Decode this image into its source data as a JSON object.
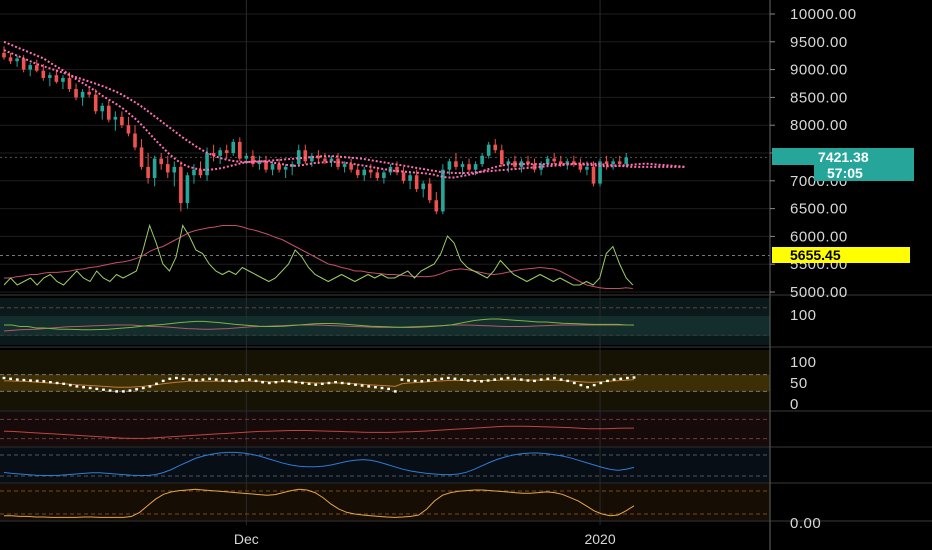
{
  "chart_data": {
    "type": "candlestick",
    "price_axis": {
      "ticks": [
        "10000.00",
        "9500.00",
        "9000.00",
        "8500.00",
        "8000.00",
        "7500.00",
        "7000.00",
        "6500.00",
        "6000.00",
        "5500.00",
        "5000.00"
      ],
      "range": [
        5000,
        10000
      ]
    },
    "last_price_tag": "7421.38",
    "countdown_tag": "57:05",
    "level_tag": "5655.45",
    "level_value": 5655.45,
    "x_labels": [
      {
        "text": "Dec",
        "index": 37
      },
      {
        "text": "2020",
        "index": 91
      }
    ],
    "candles": [
      [
        9300,
        9420,
        9180,
        9220
      ],
      [
        9220,
        9300,
        9100,
        9150
      ],
      [
        9150,
        9250,
        9050,
        9200
      ],
      [
        9200,
        9260,
        8950,
        9000
      ],
      [
        9000,
        9120,
        8880,
        9080
      ],
      [
        9080,
        9180,
        8950,
        8980
      ],
      [
        8980,
        9100,
        8800,
        8850
      ],
      [
        8850,
        8950,
        8700,
        8900
      ],
      [
        8900,
        9000,
        8750,
        8780
      ],
      [
        8780,
        8900,
        8650,
        8850
      ],
      [
        8850,
        8950,
        8600,
        8650
      ],
      [
        8650,
        8750,
        8450,
        8500
      ],
      [
        8500,
        8650,
        8350,
        8600
      ],
      [
        8600,
        8700,
        8500,
        8550
      ],
      [
        8550,
        8650,
        8200,
        8250
      ],
      [
        8250,
        8400,
        8100,
        8350
      ],
      [
        8350,
        8450,
        8050,
        8100
      ],
      [
        8100,
        8250,
        7900,
        8150
      ],
      [
        8150,
        8250,
        7950,
        8000
      ],
      [
        8000,
        8150,
        7800,
        7850
      ],
      [
        7850,
        8000,
        7550,
        7600
      ],
      [
        7600,
        7750,
        7200,
        7250
      ],
      [
        7250,
        7500,
        6950,
        7050
      ],
      [
        7050,
        7450,
        6900,
        7400
      ],
      [
        7400,
        7500,
        7200,
        7300
      ],
      [
        7300,
        7450,
        7050,
        7150
      ],
      [
        7150,
        7350,
        6900,
        7250
      ],
      [
        7250,
        7350,
        6450,
        6600
      ],
      [
        6600,
        7150,
        6500,
        7100
      ],
      [
        7100,
        7300,
        6950,
        7200
      ],
      [
        7200,
        7350,
        7050,
        7100
      ],
      [
        7100,
        7600,
        7000,
        7500
      ],
      [
        7500,
        7650,
        7350,
        7450
      ],
      [
        7450,
        7600,
        7300,
        7550
      ],
      [
        7550,
        7650,
        7400,
        7500
      ],
      [
        7500,
        7750,
        7450,
        7700
      ],
      [
        7700,
        7780,
        7350,
        7400
      ],
      [
        7400,
        7500,
        7300,
        7450
      ],
      [
        7450,
        7550,
        7250,
        7300
      ],
      [
        7300,
        7450,
        7200,
        7350
      ],
      [
        7350,
        7450,
        7150,
        7200
      ],
      [
        7200,
        7350,
        7100,
        7300
      ],
      [
        7300,
        7400,
        7150,
        7200
      ],
      [
        7200,
        7300,
        7050,
        7250
      ],
      [
        7250,
        7350,
        7100,
        7300
      ],
      [
        7300,
        7650,
        7250,
        7550
      ],
      [
        7550,
        7650,
        7300,
        7350
      ],
      [
        7350,
        7500,
        7250,
        7450
      ],
      [
        7450,
        7550,
        7300,
        7400
      ],
      [
        7400,
        7500,
        7300,
        7350
      ],
      [
        7350,
        7450,
        7250,
        7400
      ],
      [
        7400,
        7500,
        7200,
        7250
      ],
      [
        7250,
        7350,
        7150,
        7300
      ],
      [
        7300,
        7400,
        7150,
        7200
      ],
      [
        7200,
        7300,
        7050,
        7100
      ],
      [
        7100,
        7250,
        7000,
        7200
      ],
      [
        7200,
        7300,
        7050,
        7150
      ],
      [
        7150,
        7250,
        7000,
        7050
      ],
      [
        7050,
        7200,
        6950,
        7150
      ],
      [
        7150,
        7300,
        7100,
        7250
      ],
      [
        7250,
        7350,
        7100,
        7150
      ],
      [
        7150,
        7250,
        6950,
        7000
      ],
      [
        7000,
        7150,
        6850,
        7100
      ],
      [
        7100,
        7200,
        6800,
        6850
      ],
      [
        6850,
        7000,
        6700,
        6950
      ],
      [
        6950,
        7050,
        6600,
        6650
      ],
      [
        6650,
        6800,
        6400,
        6450
      ],
      [
        6450,
        7300,
        6400,
        7200
      ],
      [
        7200,
        7400,
        7100,
        7350
      ],
      [
        7350,
        7500,
        7200,
        7250
      ],
      [
        7250,
        7350,
        7100,
        7300
      ],
      [
        7300,
        7400,
        7150,
        7200
      ],
      [
        7200,
        7350,
        7100,
        7300
      ],
      [
        7300,
        7500,
        7250,
        7450
      ],
      [
        7450,
        7700,
        7400,
        7650
      ],
      [
        7650,
        7750,
        7500,
        7550
      ],
      [
        7550,
        7650,
        7250,
        7300
      ],
      [
        7300,
        7400,
        7150,
        7350
      ],
      [
        7350,
        7450,
        7200,
        7250
      ],
      [
        7250,
        7400,
        7150,
        7350
      ],
      [
        7350,
        7450,
        7250,
        7300
      ],
      [
        7300,
        7400,
        7150,
        7200
      ],
      [
        7200,
        7350,
        7100,
        7300
      ],
      [
        7300,
        7450,
        7250,
        7400
      ],
      [
        7400,
        7500,
        7300,
        7350
      ],
      [
        7350,
        7450,
        7250,
        7300
      ],
      [
        7300,
        7400,
        7200,
        7350
      ],
      [
        7350,
        7450,
        7250,
        7300
      ],
      [
        7300,
        7400,
        7150,
        7200
      ],
      [
        7200,
        7350,
        7100,
        7250
      ],
      [
        7250,
        7350,
        6900,
        6950
      ],
      [
        6950,
        7400,
        6900,
        7350
      ],
      [
        7350,
        7450,
        7200,
        7300
      ],
      [
        7300,
        7400,
        7200,
        7350
      ],
      [
        7350,
        7450,
        7250,
        7300
      ],
      [
        7300,
        7500,
        7250,
        7421
      ]
    ],
    "ma_fast": [
      9500,
      9450,
      9400,
      9350,
      9300,
      9250,
      9200,
      9120,
      9050,
      8980,
      8900,
      8820,
      8750,
      8680,
      8600,
      8520,
      8450,
      8380,
      8300,
      8200,
      8100,
      7980,
      7850,
      7720,
      7600,
      7480,
      7380,
      7300,
      7250,
      7220,
      7200,
      7200,
      7210,
      7230,
      7260,
      7290,
      7320,
      7340,
      7350,
      7350,
      7340,
      7320,
      7300,
      7280,
      7270,
      7280,
      7300,
      7320,
      7330,
      7340,
      7340,
      7330,
      7320,
      7300,
      7280,
      7260,
      7240,
      7220,
      7200,
      7180,
      7170,
      7160,
      7150,
      7140,
      7130,
      7110,
      7080,
      7060,
      7060,
      7080,
      7100,
      7130,
      7160,
      7200,
      7240,
      7270,
      7290,
      7300,
      7300,
      7300,
      7300,
      7300,
      7300,
      7300,
      7300,
      7300,
      7300,
      7300,
      7290,
      7280,
      7270,
      7260,
      7260,
      7270,
      7280,
      7290,
      7300,
      7310,
      7300,
      7290,
      7280,
      7270,
      7260,
      7250
    ],
    "ma_slow": [
      9350,
      9300,
      9250,
      9200,
      9150,
      9100,
      9060,
      9020,
      8980,
      8940,
      8900,
      8860,
      8820,
      8780,
      8740,
      8700,
      8650,
      8600,
      8540,
      8470,
      8400,
      8320,
      8230,
      8140,
      8050,
      7960,
      7870,
      7780,
      7700,
      7620,
      7550,
      7490,
      7440,
      7400,
      7370,
      7350,
      7340,
      7340,
      7340,
      7350,
      7360,
      7370,
      7380,
      7390,
      7400,
      7410,
      7420,
      7430,
      7440,
      7440,
      7440,
      7430,
      7420,
      7410,
      7400,
      7380,
      7360,
      7340,
      7320,
      7300,
      7280,
      7260,
      7240,
      7220,
      7200,
      7180,
      7160,
      7150,
      7140,
      7140,
      7140,
      7150,
      7160,
      7170,
      7180,
      7190,
      7200,
      7210,
      7220,
      7230,
      7240,
      7250,
      7260,
      7270,
      7280,
      7290,
      7300,
      7310,
      7310,
      7310,
      7300,
      7290,
      7280,
      7270,
      7260,
      7250,
      7250,
      7250,
      7250,
      7250,
      7250,
      7250,
      7250,
      7250
    ],
    "vol_green": [
      0.1,
      0.2,
      0.1,
      0.15,
      0.2,
      0.1,
      0.2,
      0.25,
      0.15,
      0.1,
      0.2,
      0.3,
      0.2,
      0.15,
      0.3,
      0.2,
      0.15,
      0.25,
      0.2,
      0.25,
      0.3,
      0.6,
      0.95,
      0.7,
      0.4,
      0.3,
      0.5,
      0.95,
      0.8,
      0.6,
      0.55,
      0.4,
      0.3,
      0.25,
      0.3,
      0.25,
      0.35,
      0.3,
      0.25,
      0.2,
      0.15,
      0.2,
      0.3,
      0.4,
      0.6,
      0.5,
      0.35,
      0.25,
      0.2,
      0.15,
      0.2,
      0.25,
      0.2,
      0.15,
      0.2,
      0.25,
      0.2,
      0.25,
      0.2,
      0.2,
      0.25,
      0.3,
      0.2,
      0.3,
      0.35,
      0.4,
      0.55,
      0.8,
      0.7,
      0.45,
      0.35,
      0.3,
      0.25,
      0.2,
      0.3,
      0.45,
      0.35,
      0.25,
      0.2,
      0.15,
      0.2,
      0.25,
      0.2,
      0.15,
      0.2,
      0.15,
      0.1,
      0.1,
      0.15,
      0.1,
      0.2,
      0.55,
      0.65,
      0.4,
      0.2,
      0.1
    ],
    "vol_red": [
      0.2,
      0.2,
      0.22,
      0.23,
      0.25,
      0.25,
      0.27,
      0.28,
      0.28,
      0.29,
      0.3,
      0.32,
      0.33,
      0.35,
      0.36,
      0.38,
      0.4,
      0.42,
      0.43,
      0.45,
      0.48,
      0.52,
      0.58,
      0.62,
      0.65,
      0.7,
      0.75,
      0.8,
      0.85,
      0.88,
      0.9,
      0.92,
      0.93,
      0.95,
      0.95,
      0.95,
      0.93,
      0.9,
      0.88,
      0.85,
      0.82,
      0.78,
      0.75,
      0.7,
      0.65,
      0.6,
      0.55,
      0.5,
      0.45,
      0.4,
      0.38,
      0.35,
      0.33,
      0.3,
      0.3,
      0.28,
      0.27,
      0.26,
      0.25,
      0.25,
      0.24,
      0.23,
      0.22,
      0.22,
      0.22,
      0.23,
      0.26,
      0.3,
      0.32,
      0.33,
      0.32,
      0.3,
      0.28,
      0.26,
      0.25,
      0.26,
      0.28,
      0.3,
      0.32,
      0.33,
      0.34,
      0.35,
      0.34,
      0.33,
      0.3,
      0.25,
      0.2,
      0.15,
      0.1,
      0.08,
      0.06,
      0.05,
      0.05,
      0.05,
      0.06,
      0.05
    ],
    "osc1_green": [
      0.5,
      0.5,
      0.45,
      0.45,
      0.4,
      0.4,
      0.38,
      0.36,
      0.36,
      0.35,
      0.34,
      0.34,
      0.35,
      0.36,
      0.38,
      0.4,
      0.42,
      0.45,
      0.48,
      0.5,
      0.52,
      0.55,
      0.58,
      0.6,
      0.62,
      0.62,
      0.6,
      0.58,
      0.55,
      0.52,
      0.5,
      0.48,
      0.46,
      0.45,
      0.45,
      0.46,
      0.48,
      0.5,
      0.52,
      0.54,
      0.55,
      0.55,
      0.54,
      0.52,
      0.5,
      0.48,
      0.46,
      0.45,
      0.44,
      0.43,
      0.42,
      0.42,
      0.43,
      0.44,
      0.46,
      0.48,
      0.5,
      0.55,
      0.6,
      0.65,
      0.68,
      0.7,
      0.7,
      0.68,
      0.66,
      0.64,
      0.62,
      0.6,
      0.6,
      0.58,
      0.56,
      0.55,
      0.54,
      0.53,
      0.52,
      0.52,
      0.52,
      0.52,
      0.5,
      0.5
    ],
    "osc1_red": [
      0.3,
      0.32,
      0.34,
      0.35,
      0.36,
      0.38,
      0.4,
      0.42,
      0.44,
      0.45,
      0.46,
      0.47,
      0.48,
      0.49,
      0.5,
      0.5,
      0.5,
      0.48,
      0.46,
      0.45,
      0.44,
      0.42,
      0.4,
      0.38,
      0.37,
      0.36,
      0.36,
      0.37,
      0.38,
      0.4,
      0.42,
      0.44,
      0.45,
      0.46,
      0.47,
      0.48,
      0.49,
      0.5,
      0.5,
      0.5,
      0.49,
      0.48,
      0.47,
      0.46,
      0.45,
      0.44,
      0.43,
      0.42,
      0.42,
      0.42,
      0.43,
      0.44,
      0.45,
      0.46,
      0.47,
      0.48,
      0.5,
      0.5,
      0.5,
      0.49,
      0.48,
      0.47,
      0.46,
      0.45,
      0.45,
      0.45,
      0.46,
      0.47,
      0.48,
      0.49,
      0.5,
      0.5,
      0.5,
      0.5,
      0.5,
      0.5,
      0.5,
      0.5,
      0.5,
      0.5
    ],
    "osc1_ticks": [
      "100"
    ],
    "rsi": [
      62,
      60,
      58,
      57,
      56,
      55,
      54,
      52,
      50,
      48,
      45,
      42,
      40,
      38,
      36,
      34,
      32,
      30,
      30,
      32,
      35,
      38,
      42,
      48,
      55,
      60,
      62,
      60,
      58,
      56,
      58,
      60,
      58,
      56,
      55,
      54,
      56,
      58,
      55,
      52,
      50,
      52,
      55,
      54,
      52,
      50,
      48,
      46,
      48,
      50,
      52,
      50,
      48,
      46,
      44,
      42,
      40,
      38,
      36,
      30,
      58,
      56,
      55,
      54,
      56,
      58,
      60,
      62,
      60,
      58,
      56,
      55,
      54,
      56,
      58,
      60,
      62,
      60,
      58,
      56,
      55,
      58,
      60,
      62,
      58,
      55,
      50,
      45,
      40,
      45,
      50,
      55,
      58,
      60,
      62,
      63
    ],
    "rsi_avg": [
      55,
      55,
      54,
      54,
      53,
      52,
      51,
      50,
      49,
      48,
      47,
      46,
      45,
      44,
      43,
      42,
      41,
      40,
      40,
      40,
      41,
      42,
      44,
      46,
      48,
      50,
      52,
      53,
      54,
      54,
      54,
      54,
      54,
      54,
      54,
      54,
      54,
      54,
      54,
      54,
      53,
      53,
      53,
      53,
      52,
      52,
      51,
      50,
      50,
      50,
      50,
      50,
      49,
      48,
      47,
      46,
      45,
      44,
      43,
      42,
      48,
      50,
      51,
      52,
      53,
      54,
      55,
      56,
      56,
      56,
      56,
      56,
      56,
      56,
      56,
      57,
      57,
      57,
      57,
      57,
      57,
      57,
      57,
      57,
      56,
      55,
      54,
      53,
      52,
      52,
      53,
      54,
      55,
      56,
      57,
      58
    ],
    "rsi_ticks": [
      "100",
      "50",
      "0"
    ],
    "osc3_red": [
      0.45,
      0.44,
      0.42,
      0.4,
      0.38,
      0.36,
      0.34,
      0.32,
      0.3,
      0.28,
      0.26,
      0.24,
      0.22,
      0.2,
      0.18,
      0.16,
      0.15,
      0.15,
      0.16,
      0.18,
      0.2,
      0.22,
      0.24,
      0.26,
      0.28,
      0.3,
      0.32,
      0.34,
      0.36,
      0.38,
      0.4,
      0.42,
      0.44,
      0.45,
      0.46,
      0.47,
      0.48,
      0.48,
      0.48,
      0.47,
      0.46,
      0.45,
      0.44,
      0.43,
      0.42,
      0.41,
      0.4,
      0.4,
      0.4,
      0.41,
      0.42,
      0.43,
      0.44,
      0.46,
      0.48,
      0.5,
      0.52,
      0.54,
      0.56,
      0.58,
      0.6,
      0.62,
      0.64,
      0.66,
      0.66,
      0.66,
      0.65,
      0.64,
      0.63,
      0.62,
      0.61,
      0.6,
      0.58,
      0.56,
      0.55,
      0.55,
      0.56,
      0.57,
      0.58,
      0.58
    ],
    "osc4_blue": [
      0.25,
      0.22,
      0.2,
      0.18,
      0.16,
      0.15,
      0.15,
      0.16,
      0.18,
      0.2,
      0.22,
      0.24,
      0.24,
      0.22,
      0.2,
      0.18,
      0.16,
      0.15,
      0.15,
      0.18,
      0.25,
      0.35,
      0.48,
      0.6,
      0.72,
      0.8,
      0.86,
      0.9,
      0.92,
      0.92,
      0.9,
      0.86,
      0.8,
      0.72,
      0.64,
      0.56,
      0.5,
      0.46,
      0.44,
      0.44,
      0.46,
      0.5,
      0.56,
      0.62,
      0.66,
      0.68,
      0.66,
      0.6,
      0.52,
      0.44,
      0.36,
      0.3,
      0.26,
      0.22,
      0.2,
      0.18,
      0.18,
      0.2,
      0.26,
      0.36,
      0.48,
      0.6,
      0.7,
      0.78,
      0.84,
      0.88,
      0.9,
      0.9,
      0.88,
      0.84,
      0.8,
      0.74,
      0.66,
      0.58,
      0.5,
      0.42,
      0.36,
      0.32,
      0.36,
      0.42
    ],
    "osc5_orange": [
      0.1,
      0.1,
      0.08,
      0.08,
      0.06,
      0.06,
      0.05,
      0.05,
      0.05,
      0.05,
      0.06,
      0.06,
      0.05,
      0.05,
      0.05,
      0.05,
      0.08,
      0.2,
      0.4,
      0.6,
      0.75,
      0.82,
      0.86,
      0.88,
      0.9,
      0.88,
      0.86,
      0.84,
      0.82,
      0.8,
      0.78,
      0.76,
      0.74,
      0.72,
      0.74,
      0.8,
      0.86,
      0.9,
      0.88,
      0.8,
      0.65,
      0.45,
      0.3,
      0.2,
      0.15,
      0.12,
      0.1,
      0.08,
      0.06,
      0.05,
      0.06,
      0.08,
      0.12,
      0.3,
      0.55,
      0.72,
      0.8,
      0.84,
      0.86,
      0.88,
      0.88,
      0.86,
      0.84,
      0.82,
      0.8,
      0.78,
      0.78,
      0.8,
      0.82,
      0.8,
      0.75,
      0.65,
      0.55,
      0.4,
      0.25,
      0.15,
      0.1,
      0.12,
      0.25,
      0.4
    ],
    "bottom_tick": "0.00",
    "colors": {
      "up": "#26a69a",
      "down": "#ef5350",
      "ma": "#ff6fb1",
      "tag_teal": "#26a69a",
      "tag_yellow": "#ffff00",
      "rsi_dots": "#ffffff",
      "blue": "#2f7bd6",
      "orange": "#e6a64a",
      "green_line": "#8bc34a"
    }
  }
}
